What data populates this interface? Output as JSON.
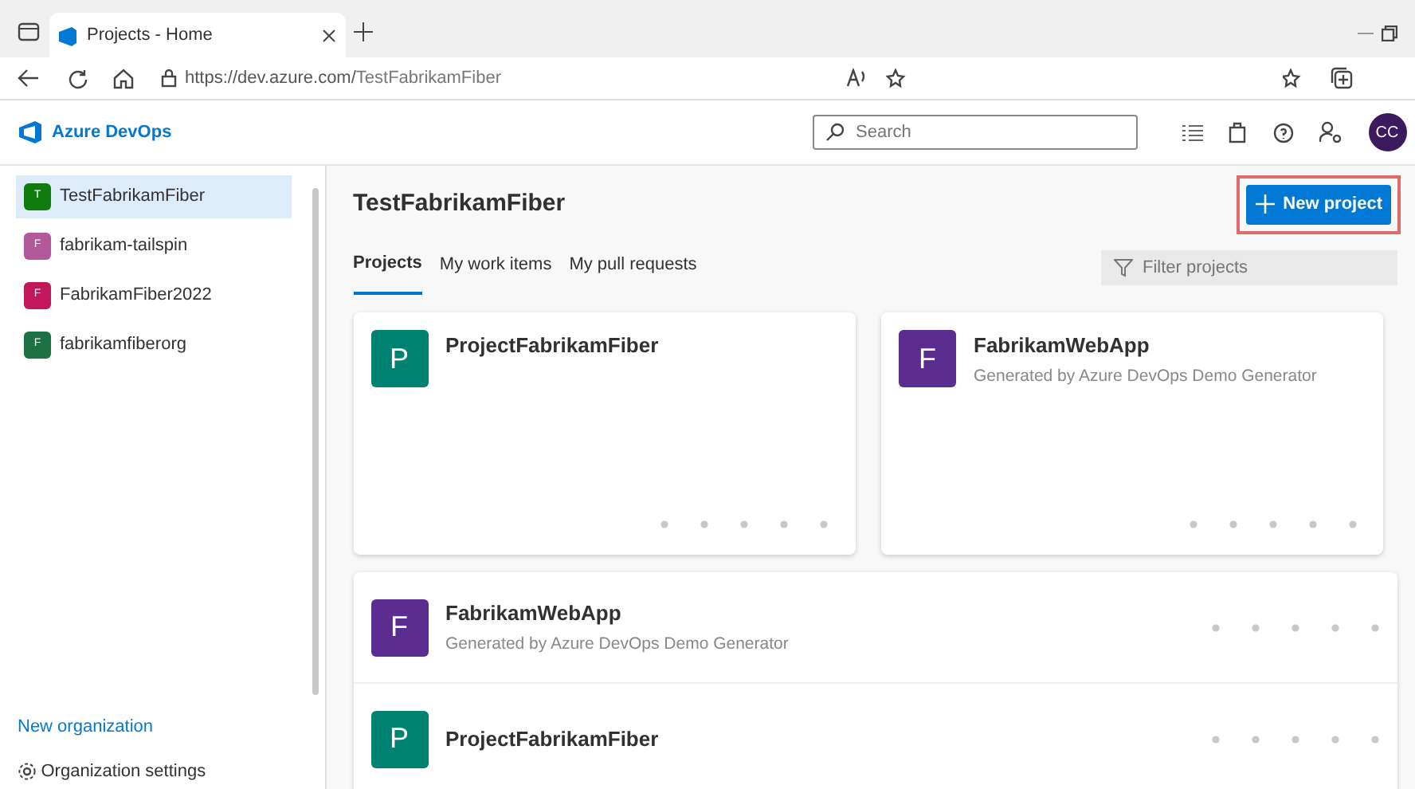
{
  "browser": {
    "tab_title": "Projects - Home",
    "url_host": "https://dev.azure.com/",
    "url_path": "TestFabrikamFiber"
  },
  "header": {
    "brand": "Azure DevOps",
    "search": {
      "placeholder": "Search"
    },
    "avatar": "CC"
  },
  "sidebar": {
    "organizations": [
      {
        "initial": "T",
        "name": "TestFabrikamFiber",
        "color": "#107c10",
        "selected": true
      },
      {
        "initial": "F",
        "name": "fabrikam-tailspin",
        "color": "#b4589b",
        "selected": false
      },
      {
        "initial": "F",
        "name": "FabrikamFiber2022",
        "color": "#c2185b",
        "selected": false
      },
      {
        "initial": "F",
        "name": "fabrikamfiberorg",
        "color": "#1e7145",
        "selected": false
      }
    ],
    "new_org": "New organization",
    "settings": "Organization settings"
  },
  "main": {
    "title": "TestFabrikamFiber",
    "new_project": "New project",
    "tabs": [
      {
        "label": "Projects",
        "selected": true
      },
      {
        "label": "My work items",
        "selected": false
      },
      {
        "label": "My pull requests",
        "selected": false
      }
    ],
    "filter": {
      "placeholder": "Filter projects"
    },
    "cards": [
      {
        "initial": "P",
        "name": "ProjectFabrikamFiber",
        "color": "#008272"
      },
      {
        "initial": "F",
        "name": "FabrikamWebApp",
        "description": "Generated by Azure DevOps Demo Generator",
        "color": "#5c2d91"
      }
    ],
    "list": [
      {
        "initial": "F",
        "name": "FabrikamWebApp",
        "description": "Generated by Azure DevOps Demo Generator",
        "color": "#5c2d91"
      },
      {
        "initial": "P",
        "name": "ProjectFabrikamFiber",
        "color": "#008272"
      }
    ]
  }
}
